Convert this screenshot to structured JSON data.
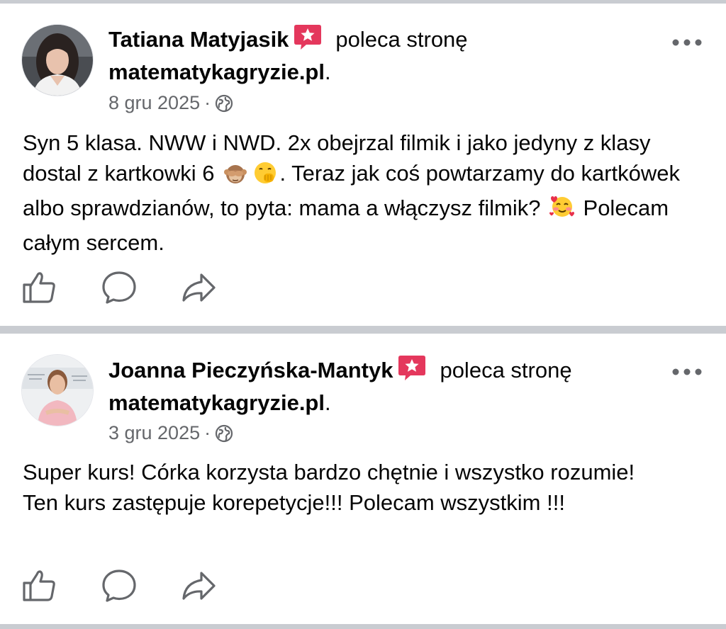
{
  "posts": [
    {
      "author": "Tatiana Matyjasik",
      "recommends": "poleca stronę",
      "page": "matematykagryzie.pl",
      "page_suffix": ".",
      "date": "8 gru 2025",
      "separator": "·",
      "text_parts": [
        "Syn 5 klasa. NWW i NWD. 2x obejrzal filmik i jako jedyny z klasy dostal z kartkowki 6",
        ". Teraz jak coś powtarzamy do kartkówek albo sprawdzianów, to pyta: mama a włączysz filmik?",
        "Polecam całym sercem."
      ],
      "emojis": [
        "see-no-evil-monkey",
        "hand-over-mouth-face",
        "smiling-face-with-hearts"
      ]
    },
    {
      "author": "Joanna Pieczyńska-Mantyk",
      "recommends": "poleca stronę",
      "page": "matematykagryzie.pl",
      "page_suffix": ".",
      "date": "3 gru 2025",
      "separator": "·",
      "text": "Super kurs! Córka korzysta bardzo chętnie i wszystko rozumie! Ten kurs zastępuje korepetycje!!! Polecam wszystkim !!!"
    }
  ],
  "icons": {
    "badge": "recommend-star-badge-icon",
    "privacy": "globe-icon",
    "menu": "more-options-icon",
    "like": "like-thumb-icon",
    "comment": "comment-bubble-icon",
    "share": "share-arrow-icon"
  },
  "colors": {
    "badge": "#e4375c",
    "meta_text": "#65676b",
    "divider": "#c9ccd1",
    "icon": "#65676b"
  }
}
